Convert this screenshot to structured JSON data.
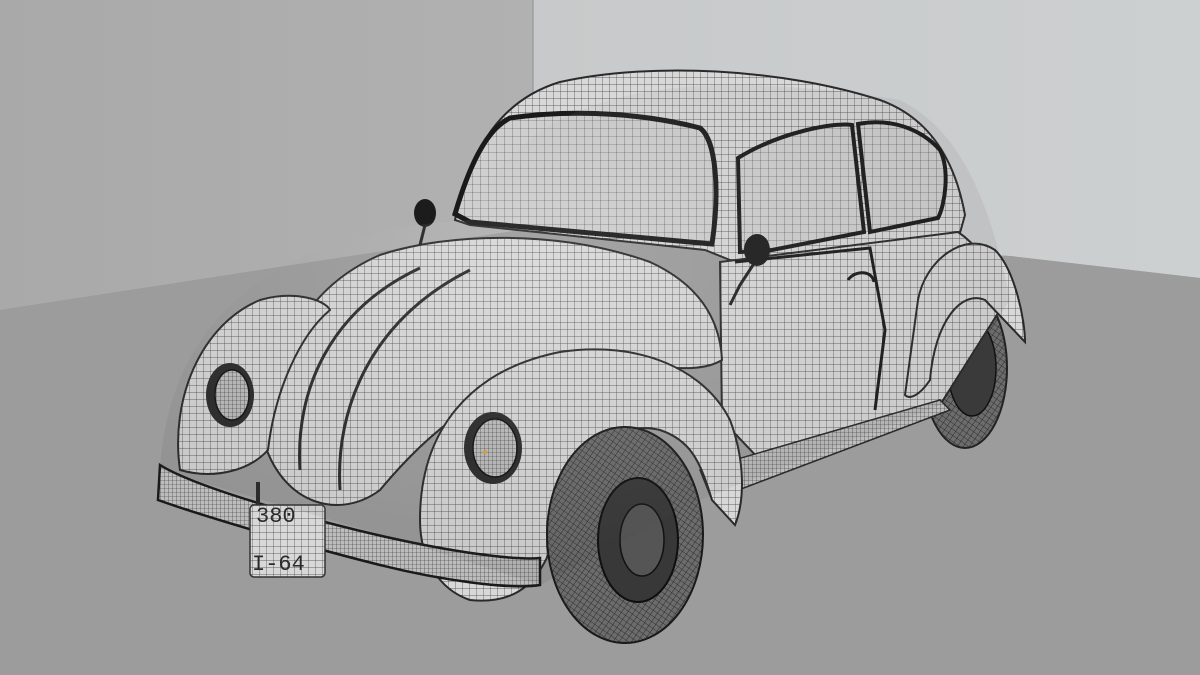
{
  "scene": {
    "subject": "car-wireframe-render",
    "license_plate": {
      "line1": "380",
      "line2": "I-64"
    },
    "colors": {
      "left_wall": "#a8a8a8",
      "back_wall": "#c9cccd",
      "floor": "#9c9c9c",
      "body": "#d6d6d6",
      "wire": "#3a3a3a",
      "tire": "#5a5a5a"
    }
  }
}
